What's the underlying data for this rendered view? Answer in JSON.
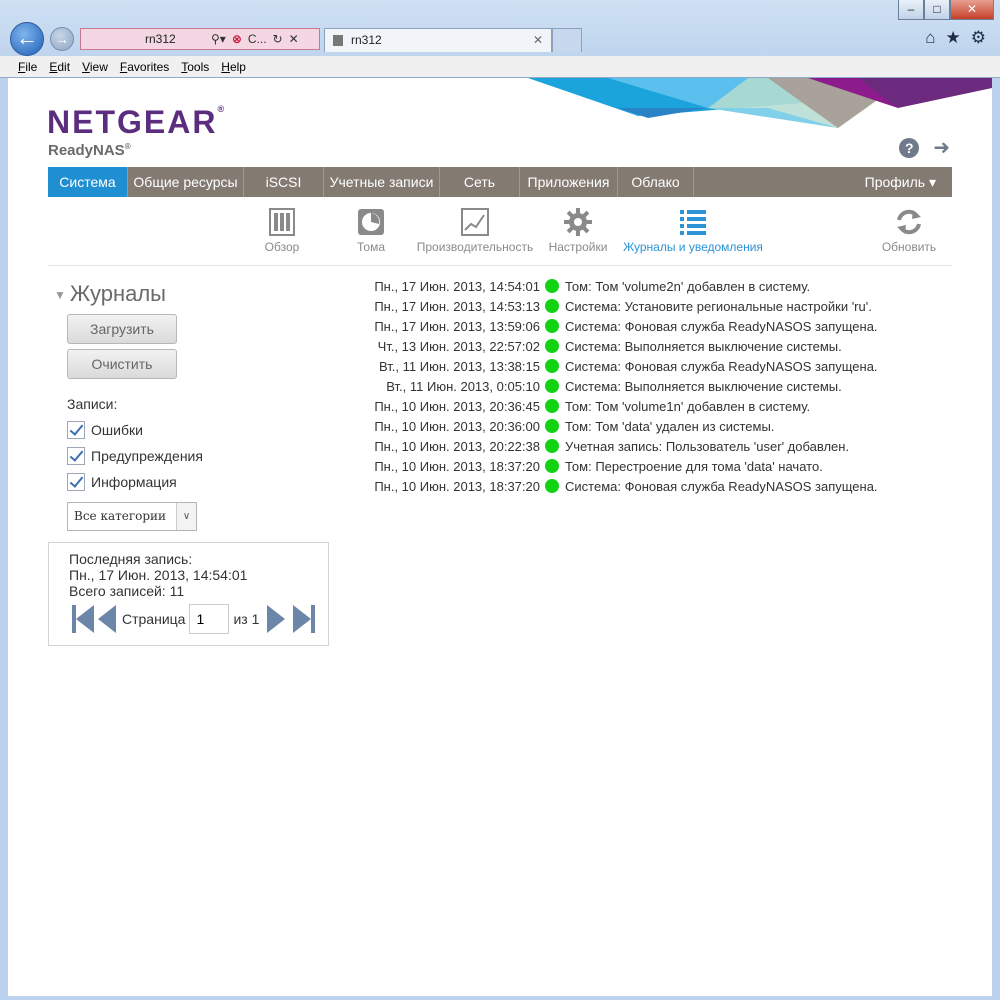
{
  "browser": {
    "address": "rn312",
    "address_tab_short": "C...",
    "tab_title": "rn312",
    "menu": [
      "File",
      "Edit",
      "View",
      "Favorites",
      "Tools",
      "Help"
    ]
  },
  "header": {
    "brand": "NETGEAR",
    "product": "ReadyNAS"
  },
  "mainnav": {
    "items": [
      "Система",
      "Общие ресурсы",
      "iSCSI",
      "Учетные записи",
      "Сеть",
      "Приложения",
      "Облако"
    ],
    "profile": "Профиль ▾"
  },
  "subnav": {
    "items": [
      "Обзор",
      "Тома",
      "Производительность",
      "Настройки",
      "Журналы и уведомления"
    ],
    "refresh": "Обновить"
  },
  "left": {
    "title": "Журналы",
    "download": "Загрузить",
    "clear": "Очистить",
    "records_label": "Записи:",
    "filters": [
      "Ошибки",
      "Предупреждения",
      "Информация"
    ],
    "category": "Все категории",
    "last_record_label": "Последняя запись:",
    "last_record_value": "Пн., 17 Июн. 2013, 14:54:01",
    "total": "Всего записей: 11",
    "page_label": "Страница",
    "page_value": "1",
    "page_of": "из 1"
  },
  "logs": [
    {
      "date": "Пн., 17 Июн. 2013, 14:54:01",
      "msg": "Том: Том 'volume2n' добавлен в систему."
    },
    {
      "date": "Пн., 17 Июн. 2013, 14:53:13",
      "msg": "Система: Установите региональные настройки 'ru'."
    },
    {
      "date": "Пн., 17 Июн. 2013, 13:59:06",
      "msg": "Система: Фоновая служба ReadyNASOS запущена."
    },
    {
      "date": "Чт., 13 Июн. 2013, 22:57:02",
      "msg": "Система: Выполняется выключение системы."
    },
    {
      "date": "Вт., 11 Июн. 2013, 13:38:15",
      "msg": "Система: Фоновая служба ReadyNASOS запущена."
    },
    {
      "date": "Вт., 11 Июн. 2013, 0:05:10",
      "msg": "Система: Выполняется выключение системы."
    },
    {
      "date": "Пн., 10 Июн. 2013, 20:36:45",
      "msg": "Том: Том 'volume1n' добавлен в систему."
    },
    {
      "date": "Пн., 10 Июн. 2013, 20:36:00",
      "msg": "Том: Том 'data' удален из системы."
    },
    {
      "date": "Пн., 10 Июн. 2013, 20:22:38",
      "msg": "Учетная запись: Пользователь 'user' добавлен."
    },
    {
      "date": "Пн., 10 Июн. 2013, 18:37:20",
      "msg": "Том: Перестроение для тома 'data' начато."
    },
    {
      "date": "Пн., 10 Июн. 2013, 18:37:20",
      "msg": "Система: Фоновая служба ReadyNASOS запущена."
    }
  ],
  "colors": {
    "accent": "#1f8fd1",
    "nav": "#837b72",
    "brand": "#5c2d7e",
    "status_ok": "#12d212"
  }
}
